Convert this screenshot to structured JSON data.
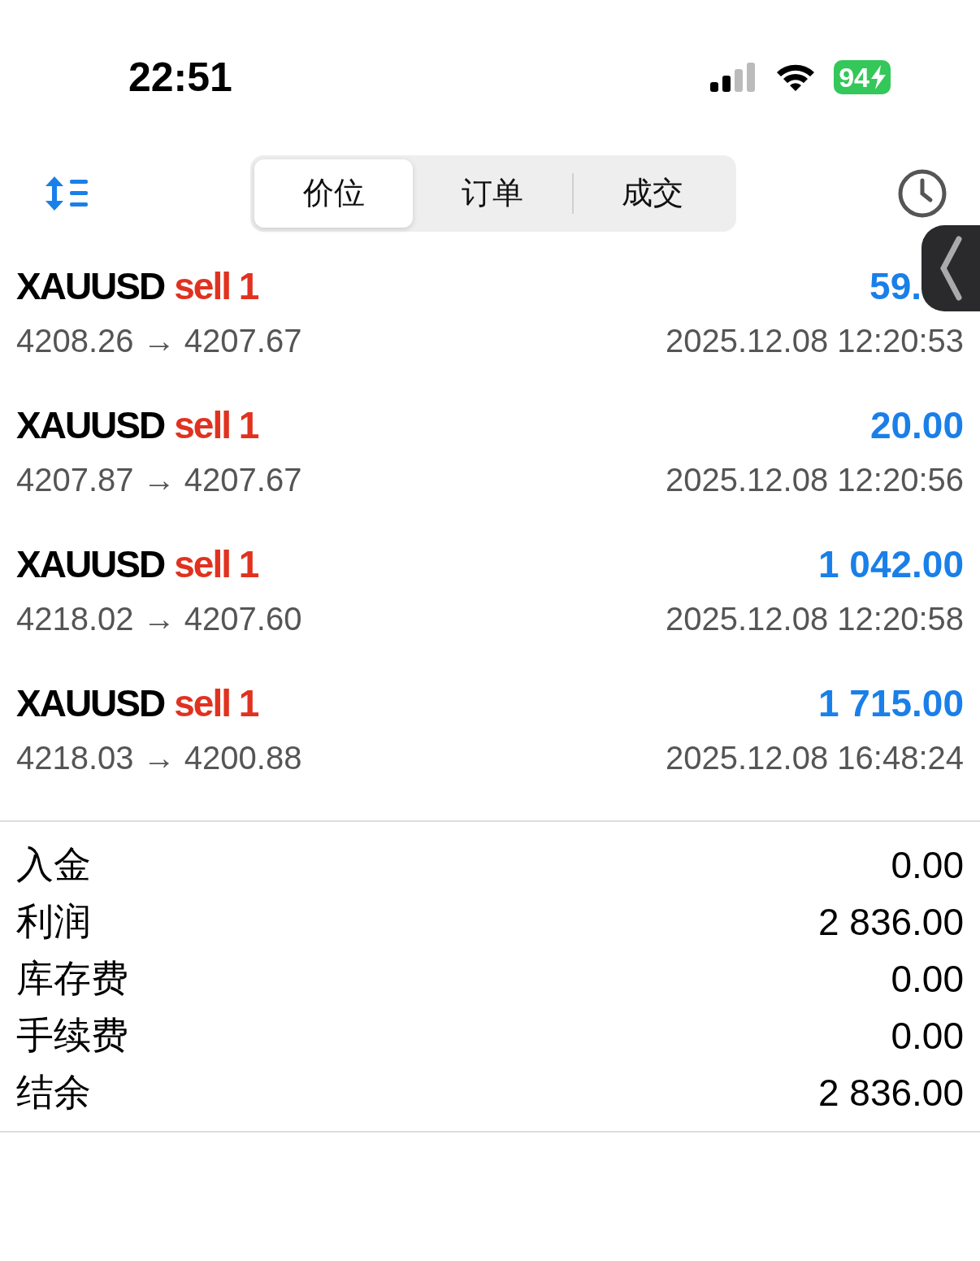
{
  "status_bar": {
    "time": "22:51",
    "battery": "94"
  },
  "tabs": [
    {
      "label": "价位",
      "selected": true
    },
    {
      "label": "订单",
      "selected": false
    },
    {
      "label": "成交",
      "selected": false
    }
  ],
  "deals": [
    {
      "symbol": "XAUUSD",
      "type": "sell 1",
      "prices": "4208.26 → 4207.67",
      "profit": "59.",
      "time": "2025.12.08 12:20:53"
    },
    {
      "symbol": "XAUUSD",
      "type": "sell 1",
      "prices": "4207.87 → 4207.67",
      "profit": "20.00",
      "time": "2025.12.08 12:20:56"
    },
    {
      "symbol": "XAUUSD",
      "type": "sell 1",
      "prices": "4218.02 → 4207.60",
      "profit": "1 042.00",
      "time": "2025.12.08 12:20:58"
    },
    {
      "symbol": "XAUUSD",
      "type": "sell 1",
      "prices": "4218.03 → 4200.88",
      "profit": "1 715.00",
      "time": "2025.12.08 16:48:24"
    }
  ],
  "summary": [
    {
      "label": "入金",
      "value": "0.00"
    },
    {
      "label": "利润",
      "value": "2 836.00"
    },
    {
      "label": "库存费",
      "value": "0.00"
    },
    {
      "label": "手续费",
      "value": "0.00"
    },
    {
      "label": "结余",
      "value": "2 836.00"
    }
  ]
}
